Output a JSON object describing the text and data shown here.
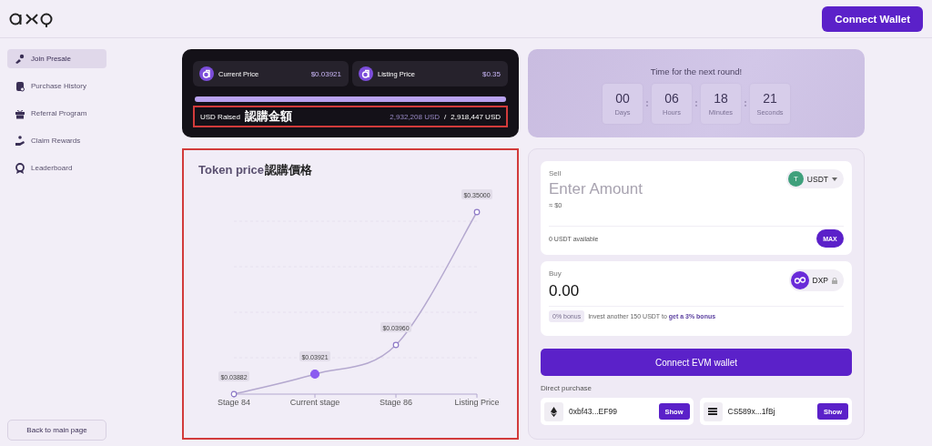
{
  "header": {
    "connect_button": "Connect Wallet"
  },
  "sidebar": {
    "items": [
      {
        "label": "Join Presale",
        "selected": true
      },
      {
        "label": "Purchase History",
        "selected": false
      },
      {
        "label": "Referral Program",
        "selected": false
      },
      {
        "label": "Claim Rewards",
        "selected": false
      },
      {
        "label": "Leaderboard",
        "selected": false
      }
    ],
    "back_button": "Back to main page"
  },
  "sale": {
    "prices": [
      {
        "label": "Current Price",
        "value": "$0.03921"
      },
      {
        "label": "Listing Price",
        "value": "$0.35"
      }
    ],
    "progress": {
      "level": 1
    },
    "raised_label": "USD Raised",
    "raised_note": "認購金額",
    "raised": "2,932,208 USD",
    "separator": "/",
    "goal": "2,918,447 USD"
  },
  "countdown": {
    "title": "Time for the next round!",
    "units": [
      {
        "value": "00",
        "label": "Days"
      },
      {
        "value": "06",
        "label": "Hours"
      },
      {
        "value": "18",
        "label": "Minutes"
      },
      {
        "value": "21",
        "label": "Seconds"
      }
    ]
  },
  "token_price": {
    "title": "Token price",
    "title_note": "認購價格",
    "points": [
      {
        "category": "Stage 84",
        "price": "$0.03882",
        "current": false
      },
      {
        "category": "Current stage",
        "price": "$0.03921",
        "current": true
      },
      {
        "category": "Stage 86",
        "price": "$0.03960",
        "current": false
      },
      {
        "category": "Listing Price",
        "price": "$0.35000",
        "current": false
      }
    ]
  },
  "swap": {
    "sell": {
      "label": "Sell",
      "placeholder": "Enter Amount",
      "usd": "≈ $0",
      "token": "USDT",
      "token_letter": "T",
      "available": "0 USDT available",
      "max_button": "MAX"
    },
    "buy": {
      "label": "Buy",
      "value": "0.00",
      "token": "DXP",
      "bonus_badge": "0% bonus",
      "bonus_text": "Invest another 150 USDT to **get a 3% bonus**"
    },
    "connect_button": "Connect EVM wallet",
    "direct_label": "Direct purchase",
    "addresses": [
      {
        "kind": "eth",
        "address": "0xbf43...EF99",
        "button": "Show"
      },
      {
        "kind": "sol",
        "address": "CS589x...1fBj",
        "button": "Show"
      }
    ]
  }
}
